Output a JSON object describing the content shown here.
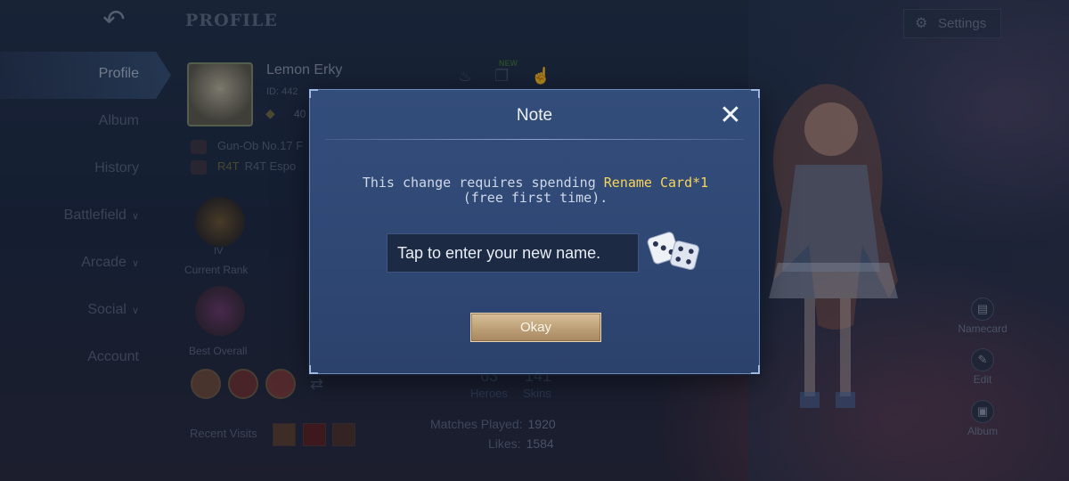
{
  "header": {
    "back_icon": "back-arrow-icon",
    "title": "PROFILE",
    "settings_label": "Settings"
  },
  "nav": {
    "items": [
      {
        "label": "Profile",
        "active": true
      },
      {
        "label": "Album"
      },
      {
        "label": "History"
      },
      {
        "label": "Battlefield",
        "chevron": true
      },
      {
        "label": "Arcade",
        "chevron": true
      },
      {
        "label": "Social",
        "chevron": true
      },
      {
        "label": "Account"
      }
    ]
  },
  "profile": {
    "name": "Lemon Erky",
    "id_prefix": "ID: 442",
    "level_prefix": "40",
    "squad_line": "Gun-Ob No.17 F",
    "team_tag": "R4T",
    "team_name": "R4T Espo",
    "current_rank_label": "Current Rank",
    "best_overall_label": "Best Overall",
    "rank_roman": "IV",
    "recent_visits_label": "Recent Visits",
    "heroes_count": "63",
    "heroes_label": "Heroes",
    "skins_count": "141",
    "skins_label": "Skins",
    "matches_played_label": "Matches Played:",
    "matches_played_value": "1920",
    "likes_label": "Likes:",
    "likes_value": "1584",
    "new_tag": "NEW"
  },
  "side_buttons": {
    "namecard": "Namecard",
    "edit": "Edit",
    "album": "Album"
  },
  "dialog": {
    "title": "Note",
    "message_part1": "This change requires spending ",
    "message_highlight": "Rename Card*1",
    "message_part2": " (free first time).",
    "input_placeholder": "Tap to enter your new name.",
    "input_value": "",
    "ok_label": "Okay",
    "close_icon": "close-icon",
    "dice_icon": "dice-icon"
  },
  "colors": {
    "highlight": "#f5d65b",
    "dialog_bg": "#334d7b",
    "ok_button": "#bfa27a"
  }
}
